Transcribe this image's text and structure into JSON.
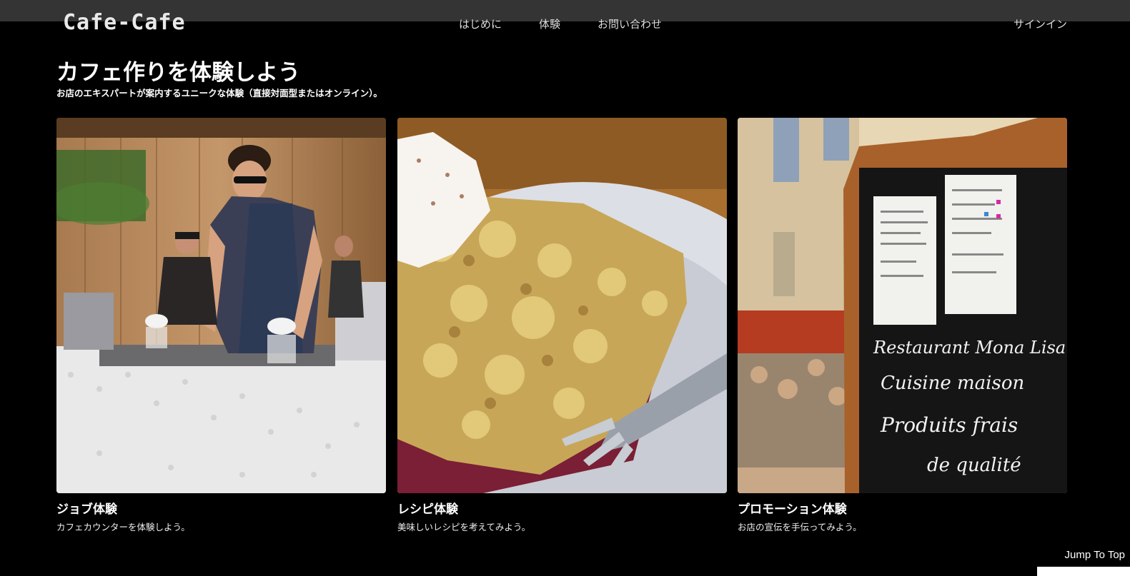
{
  "header": {
    "logo": "Cafe-Cafe",
    "nav": [
      {
        "label": "はじめに"
      },
      {
        "label": "体験"
      },
      {
        "label": "お問い合わせ"
      }
    ],
    "signin": "サインイン"
  },
  "hero": {
    "title": "カフェ作りを体験しよう",
    "subtitle": "お店のエキスパートが案内するユニークな体験（直接対面型またはオンライン）。"
  },
  "cards": [
    {
      "title": "ジョブ体験",
      "desc": "カフェカウンターを体験しよう。"
    },
    {
      "title": "レシピ体験",
      "desc": "美味しいレシピを考えてみよう。"
    },
    {
      "title": "プロモーション体験",
      "desc": "お店の宣伝を手伝ってみよう。"
    }
  ],
  "board_text": [
    "Restaurant Mona Lisa",
    "Cuisine maison",
    "Produits frais",
    "de qualité"
  ],
  "footer": {
    "jump": "Jump To Top"
  }
}
